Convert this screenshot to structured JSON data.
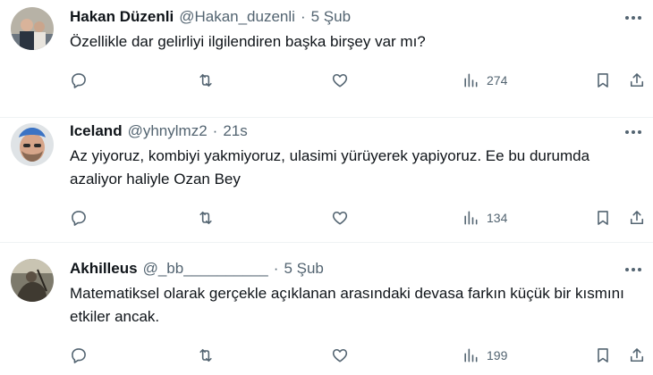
{
  "tweets": [
    {
      "name": "Hakan Düzenli",
      "handle": "@Hakan_duzenli",
      "separator": "·",
      "time": "5 Şub",
      "text": "Özellikle dar gelirliyi ilgilendiren başka birşey var mı?",
      "views": "274"
    },
    {
      "name": "Iceland",
      "handle": "@yhnylmz2",
      "separator": "·",
      "time": "21s",
      "text": "Az yiyoruz, kombiyi yakmiyoruz, ulasimi yürüyerek yapiyoruz. Ee bu durumda azaliyor haliyle Ozan Bey",
      "views": "134"
    },
    {
      "name": "Akhilleus",
      "handle": "@_bb__________",
      "separator": "·",
      "time": "5 Şub",
      "text": "Matematiksel olarak gerçekle açıklanan arasındaki devasa farkın küçük bir kısmını etkiler ancak.",
      "views": "199"
    }
  ],
  "icons": {
    "more": "more-icon",
    "reply": "reply-icon",
    "retweet": "retweet-icon",
    "like": "heart-icon",
    "views": "views-icon",
    "bookmark": "bookmark-icon",
    "share": "share-icon"
  },
  "colors": {
    "text": "#0f1419",
    "secondary": "#536471",
    "divider": "#eff3f4"
  }
}
